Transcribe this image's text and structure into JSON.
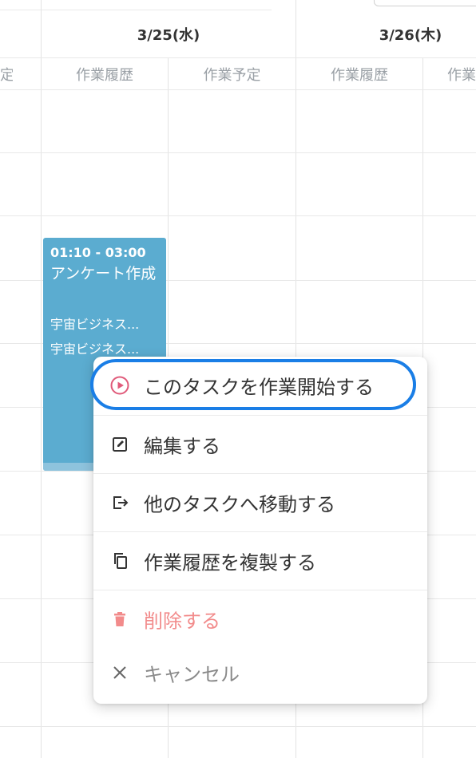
{
  "calendar": {
    "left_partial_subheader": "定",
    "days": [
      {
        "date": "3/25(水)",
        "col_history": "作業履歴",
        "col_plan": "作業予定"
      },
      {
        "date": "3/26(木)",
        "col_history": "作業履歴",
        "col_plan": "作業"
      }
    ]
  },
  "event": {
    "time": "01:10 - 03:00",
    "title": "アンケート作成",
    "sub1": "宇宙ビジネス...",
    "sub2": "宇宙ビジネス...",
    "color": "#5bacd0"
  },
  "context_menu": {
    "items": [
      {
        "label": "このタスクを作業開始する",
        "icon": "play-circle-icon"
      },
      {
        "label": "編集する",
        "icon": "edit-icon"
      },
      {
        "label": "他のタスクへ移動する",
        "icon": "move-out-icon"
      },
      {
        "label": "作業履歴を複製する",
        "icon": "copy-icon"
      },
      {
        "label": "削除する",
        "icon": "trash-icon"
      },
      {
        "label": "キャンセル",
        "icon": "close-icon"
      }
    ],
    "highlight_color": "#1a7ee6",
    "danger_color": "#f28b8b"
  }
}
